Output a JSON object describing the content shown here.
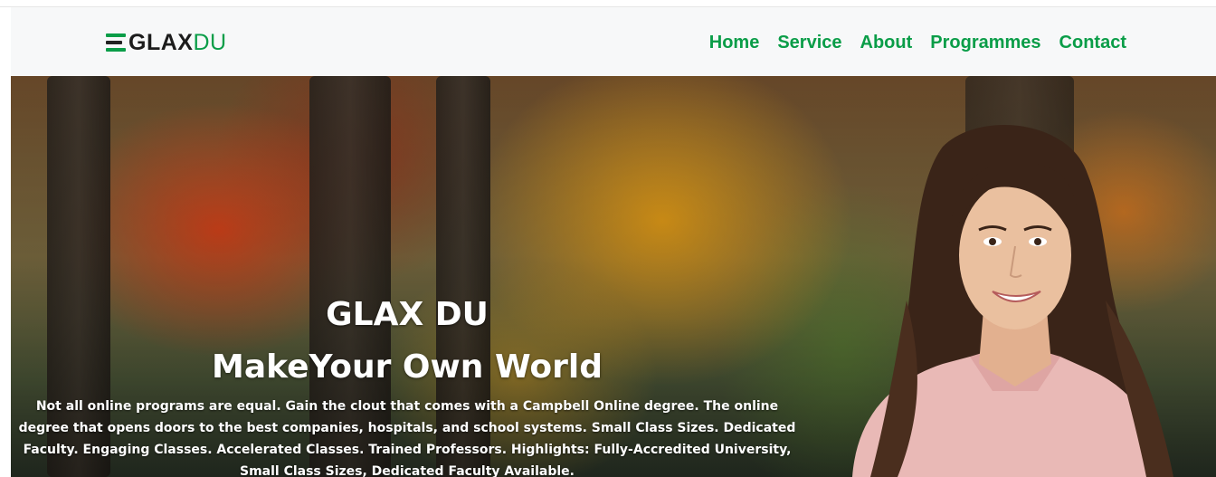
{
  "brand": {
    "logo_part1": "GLAX",
    "logo_part2": "DU",
    "primary_color": "#0a9d48",
    "dark_color": "#1c1c1c"
  },
  "nav": {
    "items": [
      {
        "label": "Home"
      },
      {
        "label": "Service"
      },
      {
        "label": "About"
      },
      {
        "label": "Programmes"
      },
      {
        "label": "Contact"
      }
    ]
  },
  "hero": {
    "title": "GLAX DU",
    "subtitle": "MakeYour Own World",
    "text": "Not all online programs are equal. Gain the clout that comes with a Campbell Online degree. The online degree that opens doors to the best companies, hospitals, and school systems. Small Class Sizes. Dedicated Faculty. Engaging Classes. Accelerated Classes. Trained Professors. Highlights: Fully-Accredited University, Small Class Sizes, Dedicated Faculty Available.",
    "background_icon": "autumn-campus-photo",
    "person_icon": "smiling-student-photo"
  }
}
